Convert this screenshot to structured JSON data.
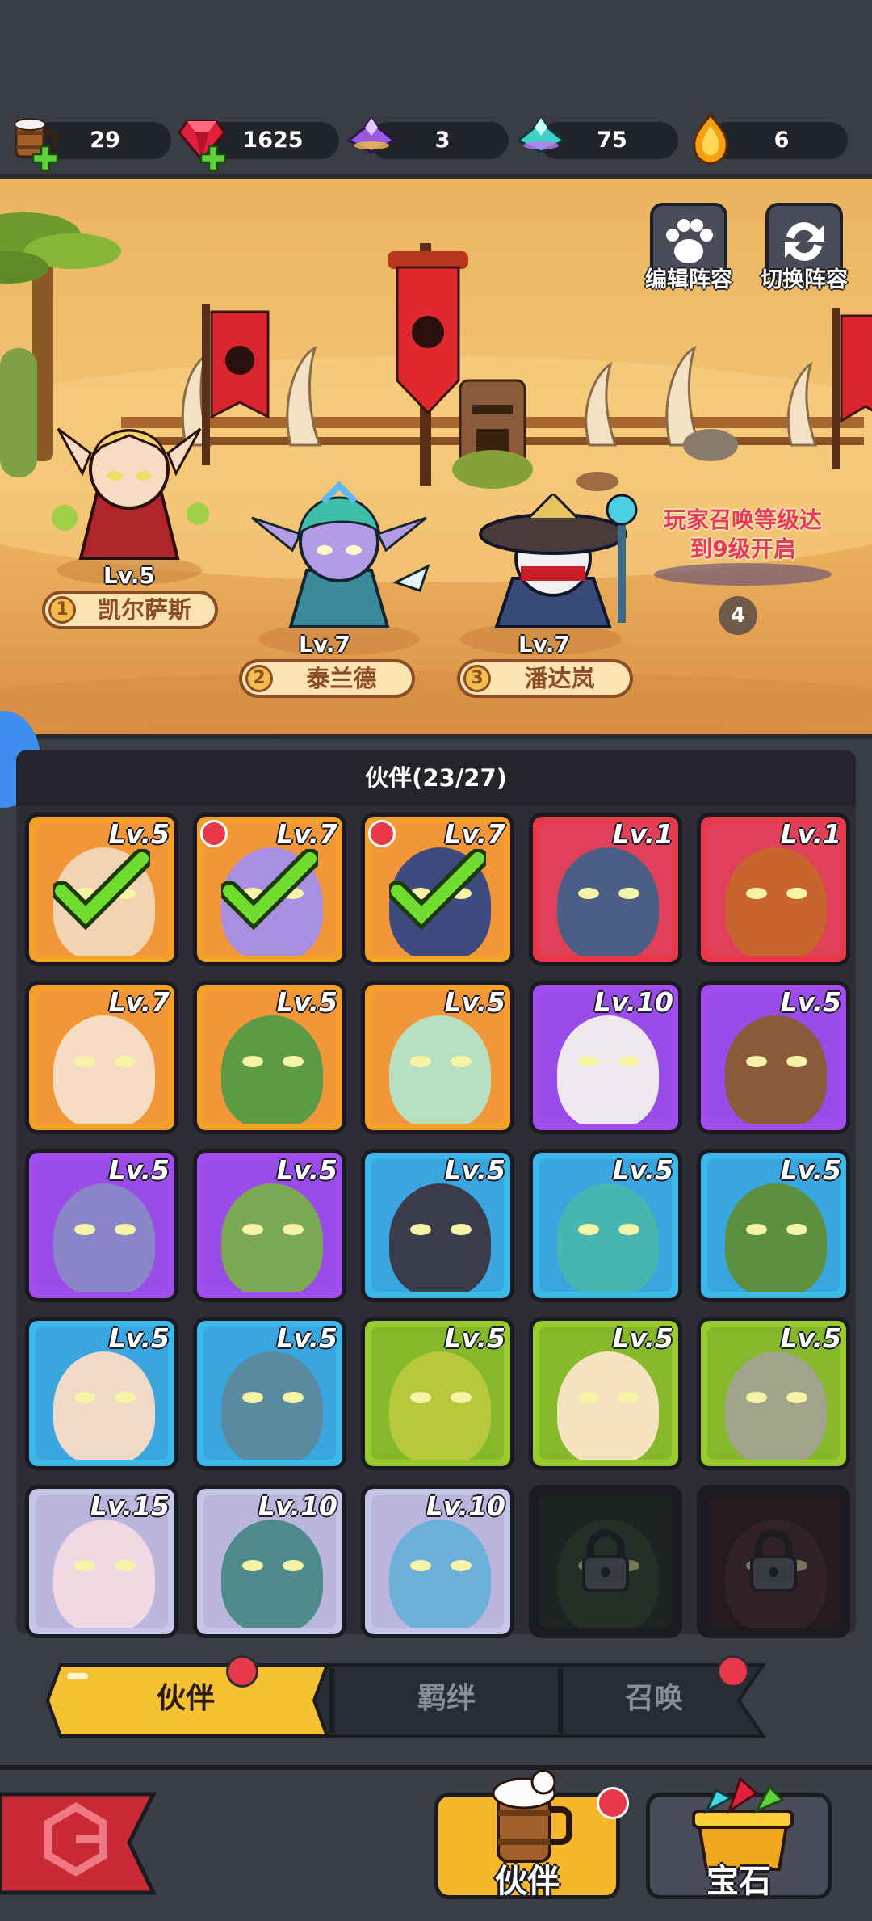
{
  "resources": [
    {
      "icon": "mug-icon",
      "value": "29",
      "has_plus": true
    },
    {
      "icon": "ruby-icon",
      "value": "1625",
      "has_plus": true
    },
    {
      "icon": "purple-crystal-icon",
      "value": "3",
      "has_plus": false
    },
    {
      "icon": "teal-crystal-icon",
      "value": "75",
      "has_plus": false
    },
    {
      "icon": "flame-gem-icon",
      "value": "6",
      "has_plus": false
    }
  ],
  "field": {
    "edit_lineup_label": "编辑阵容",
    "switch_lineup_label": "切换阵容",
    "lineup": [
      {
        "slot": "1",
        "name": "凯尔萨斯",
        "level": "Lv.5"
      },
      {
        "slot": "2",
        "name": "泰兰德",
        "level": "Lv.7"
      },
      {
        "slot": "3",
        "name": "潘达岚",
        "level": "Lv.7"
      }
    ],
    "unlock_line1": "玩家召唤等级达",
    "unlock_line2": "到9级开启",
    "slot4": "4"
  },
  "panel": {
    "title": "伙伴(23/27)",
    "cards": [
      {
        "level": "Lv.5",
        "frame": "#f4a12a",
        "bg": "#f2963a",
        "face": "#f3d4b2",
        "selected": true,
        "dot": false,
        "locked": false
      },
      {
        "level": "Lv.7",
        "frame": "#f4a12a",
        "bg": "#f2963a",
        "face": "#a88fe0",
        "selected": true,
        "dot": true,
        "locked": false
      },
      {
        "level": "Lv.7",
        "frame": "#f4a12a",
        "bg": "#f2963a",
        "face": "#3f4a7e",
        "selected": true,
        "dot": true,
        "locked": false
      },
      {
        "level": "Lv.1",
        "frame": "#e8394a",
        "bg": "#e0405a",
        "face": "#4b5f86",
        "selected": false,
        "dot": false,
        "locked": false
      },
      {
        "level": "Lv.1",
        "frame": "#e8394a",
        "bg": "#e0405a",
        "face": "#c8652e",
        "selected": false,
        "dot": false,
        "locked": false
      },
      {
        "level": "Lv.7",
        "frame": "#f4a12a",
        "bg": "#f2963a",
        "face": "#f6dcc2",
        "selected": false,
        "dot": false,
        "locked": false
      },
      {
        "level": "Lv.5",
        "frame": "#f4a12a",
        "bg": "#f2963a",
        "face": "#5c9a44",
        "selected": false,
        "dot": false,
        "locked": false
      },
      {
        "level": "Lv.5",
        "frame": "#f4a12a",
        "bg": "#f2963a",
        "face": "#b7e0c0",
        "selected": false,
        "dot": false,
        "locked": false
      },
      {
        "level": "Lv.10",
        "frame": "#a14df0",
        "bg": "#9a4ce8",
        "face": "#efe7ee",
        "selected": false,
        "dot": false,
        "locked": false
      },
      {
        "level": "Lv.5",
        "frame": "#a14df0",
        "bg": "#9a4ce8",
        "face": "#8a5a3a",
        "selected": false,
        "dot": false,
        "locked": false
      },
      {
        "level": "Lv.5",
        "frame": "#a14df0",
        "bg": "#9a4ce8",
        "face": "#8a84c8",
        "selected": false,
        "dot": false,
        "locked": false
      },
      {
        "level": "Lv.5",
        "frame": "#a14df0",
        "bg": "#9a4ce8",
        "face": "#7aa853",
        "selected": false,
        "dot": false,
        "locked": false
      },
      {
        "level": "Lv.5",
        "frame": "#3db8ea",
        "bg": "#3aa6e0",
        "face": "#3a3c4c",
        "selected": false,
        "dot": false,
        "locked": false
      },
      {
        "level": "Lv.5",
        "frame": "#3db8ea",
        "bg": "#3aa6e0",
        "face": "#48b6b0",
        "selected": false,
        "dot": false,
        "locked": false
      },
      {
        "level": "Lv.5",
        "frame": "#3db8ea",
        "bg": "#3aa6e0",
        "face": "#5c8f3e",
        "selected": false,
        "dot": false,
        "locked": false
      },
      {
        "level": "Lv.5",
        "frame": "#3db8ea",
        "bg": "#3aa6e0",
        "face": "#f1d9c8",
        "selected": false,
        "dot": false,
        "locked": false
      },
      {
        "level": "Lv.5",
        "frame": "#3db8ea",
        "bg": "#3aa6e0",
        "face": "#5a8aa0",
        "selected": false,
        "dot": false,
        "locked": false
      },
      {
        "level": "Lv.5",
        "frame": "#9acb2c",
        "bg": "#86b82c",
        "face": "#b8c83c",
        "selected": false,
        "dot": false,
        "locked": false
      },
      {
        "level": "Lv.5",
        "frame": "#9acb2c",
        "bg": "#86b82c",
        "face": "#f4e2c0",
        "selected": false,
        "dot": false,
        "locked": false
      },
      {
        "level": "Lv.5",
        "frame": "#9acb2c",
        "bg": "#86b82c",
        "face": "#a0a48a",
        "selected": false,
        "dot": false,
        "locked": false
      },
      {
        "level": "Lv.15",
        "frame": "#c8c6e8",
        "bg": "#b9b5dc",
        "face": "#f0d8e2",
        "selected": false,
        "dot": false,
        "locked": false
      },
      {
        "level": "Lv.10",
        "frame": "#c8c6e8",
        "bg": "#b9b5dc",
        "face": "#4f8a8a",
        "selected": false,
        "dot": false,
        "locked": false
      },
      {
        "level": "Lv.10",
        "frame": "#c8c6e8",
        "bg": "#b9b5dc",
        "face": "#6cb0d8",
        "selected": false,
        "dot": false,
        "locked": false
      },
      {
        "level": "",
        "frame": "#2a2c34",
        "bg": "#2f3f32",
        "face": "#3c5a3e",
        "selected": false,
        "dot": false,
        "locked": true
      },
      {
        "level": "",
        "frame": "#2a2c34",
        "bg": "#3f2a2e",
        "face": "#5a3a3e",
        "selected": false,
        "dot": false,
        "locked": true
      }
    ]
  },
  "tabs": [
    {
      "label": "伙伴",
      "active": true,
      "dot": true
    },
    {
      "label": "羁绊",
      "active": false,
      "dot": false
    },
    {
      "label": "召唤",
      "active": false,
      "dot": true
    }
  ],
  "nav": {
    "back_icon": "back-arrow-icon",
    "partner_label": "伙伴",
    "gem_label": "宝石"
  },
  "colors": {
    "accent": "#f4bd2e",
    "alert": "#e8394a",
    "panel": "#2c2d35"
  }
}
